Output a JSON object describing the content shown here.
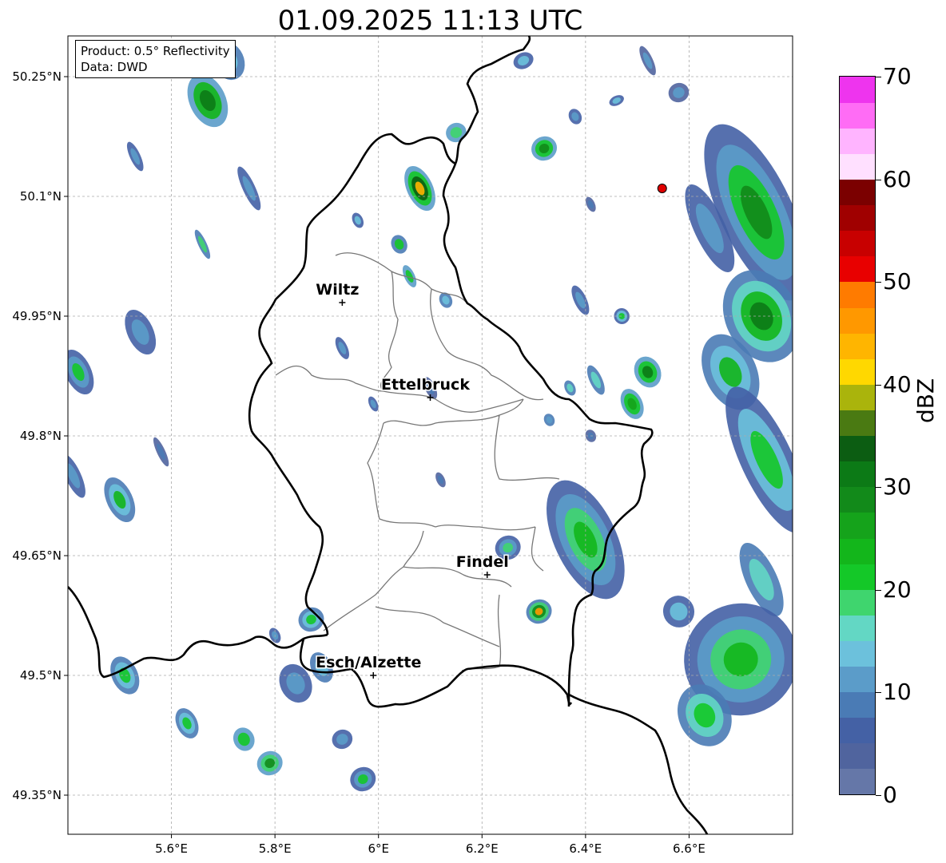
{
  "title": "01.09.2025 11:13 UTC",
  "info": {
    "product": "Product: 0.5° Reflectivity",
    "source": "Data: DWD"
  },
  "axes": {
    "lat_labels": [
      {
        "value": 50.25,
        "text": "50.25°N"
      },
      {
        "value": 50.1,
        "text": "50.1°N"
      },
      {
        "value": 49.95,
        "text": "49.95°N"
      },
      {
        "value": 49.8,
        "text": "49.8°N"
      },
      {
        "value": 49.65,
        "text": "49.65°N"
      },
      {
        "value": 49.5,
        "text": "49.5°N"
      },
      {
        "value": 49.35,
        "text": "49.35°N"
      }
    ],
    "lon_labels": [
      {
        "value": 5.6,
        "text": "5.6°E"
      },
      {
        "value": 5.8,
        "text": "5.8°E"
      },
      {
        "value": 6.0,
        "text": "6°E"
      },
      {
        "value": 6.2,
        "text": "6.2°E"
      },
      {
        "value": 6.4,
        "text": "6.4°E"
      },
      {
        "value": 6.6,
        "text": "6.6°E"
      }
    ],
    "lon_range": [
      5.4,
      6.8
    ],
    "lat_range": [
      49.3,
      50.3
    ],
    "grid": true
  },
  "places": [
    {
      "name": "Wiltz",
      "lon": 5.93,
      "lat": 49.967
    },
    {
      "name": "Ettelbruck",
      "lon": 6.1,
      "lat": 49.848
    },
    {
      "name": "Findel",
      "lon": 6.21,
      "lat": 49.626
    },
    {
      "name": "Esch/Alzette",
      "lon": 5.99,
      "lat": 49.5
    }
  ],
  "radar_site": {
    "lon": 6.548,
    "lat": 50.11,
    "color": "#e00000"
  },
  "colorbar": {
    "unit": "dBZ",
    "min": 0,
    "max": 70,
    "tick_labels": [
      {
        "value": 0,
        "text": "0"
      },
      {
        "value": 10,
        "text": "10"
      },
      {
        "value": 20,
        "text": "20"
      },
      {
        "value": 30,
        "text": "30"
      },
      {
        "value": 40,
        "text": "40"
      },
      {
        "value": 50,
        "text": "50"
      },
      {
        "value": 60,
        "text": "60"
      },
      {
        "value": 70,
        "text": "70"
      }
    ],
    "colors": [
      "#6577a8",
      "#50649e",
      "#4461a5",
      "#4a7bb5",
      "#5b9cc9",
      "#6cc1dc",
      "#63d7c4",
      "#3fd56e",
      "#14c828",
      "#13b61b",
      "#15a31b",
      "#128a1a",
      "#0c7a16",
      "#0c5d12",
      "#4a7a12",
      "#aab40c",
      "#ffd800",
      "#ffb500",
      "#ff9800",
      "#ff7b00",
      "#e80000",
      "#c80000",
      "#a00000",
      "#7b0000",
      "#ffe0ff",
      "#ffb4ff",
      "#ff6cf5",
      "#ee34ee"
    ]
  },
  "echo_cells": [
    {
      "lon": 5.67,
      "lat": 50.22,
      "rx": 0.035,
      "ry": 0.035,
      "dbz": [
        12,
        24,
        32
      ]
    },
    {
      "lon": 5.71,
      "lat": 50.27,
      "rx": 0.03,
      "ry": 0.025,
      "dbz": [
        8,
        14
      ]
    },
    {
      "lon": 5.53,
      "lat": 50.15,
      "rx": 0.01,
      "ry": 0.02,
      "dbz": [
        6,
        10
      ]
    },
    {
      "lon": 5.75,
      "lat": 50.11,
      "rx": 0.012,
      "ry": 0.03,
      "dbz": [
        5,
        10
      ]
    },
    {
      "lon": 5.66,
      "lat": 50.04,
      "rx": 0.008,
      "ry": 0.02,
      "dbz": [
        8,
        18
      ]
    },
    {
      "lon": 5.96,
      "lat": 50.07,
      "rx": 0.01,
      "ry": 0.01,
      "dbz": [
        6,
        14
      ]
    },
    {
      "lon": 6.04,
      "lat": 50.04,
      "rx": 0.015,
      "ry": 0.012,
      "dbz": [
        8,
        20
      ]
    },
    {
      "lon": 6.08,
      "lat": 50.11,
      "rx": 0.025,
      "ry": 0.03,
      "dbz": [
        10,
        22,
        34,
        44
      ]
    },
    {
      "lon": 6.15,
      "lat": 50.18,
      "rx": 0.02,
      "ry": 0.012,
      "dbz": [
        10,
        18
      ]
    },
    {
      "lon": 6.06,
      "lat": 50.0,
      "rx": 0.01,
      "ry": 0.015,
      "dbz": [
        10,
        22
      ]
    },
    {
      "lon": 6.13,
      "lat": 49.97,
      "rx": 0.012,
      "ry": 0.01,
      "dbz": [
        8,
        14
      ]
    },
    {
      "lon": 6.28,
      "lat": 50.27,
      "rx": 0.02,
      "ry": 0.01,
      "dbz": [
        6,
        14
      ]
    },
    {
      "lon": 6.32,
      "lat": 50.16,
      "rx": 0.025,
      "ry": 0.015,
      "dbz": [
        10,
        20,
        28
      ]
    },
    {
      "lon": 6.38,
      "lat": 50.2,
      "rx": 0.012,
      "ry": 0.01,
      "dbz": [
        6,
        12
      ]
    },
    {
      "lon": 6.52,
      "lat": 50.27,
      "rx": 0.01,
      "ry": 0.02,
      "dbz": [
        4,
        10
      ]
    },
    {
      "lon": 6.58,
      "lat": 50.23,
      "rx": 0.02,
      "ry": 0.012,
      "dbz": [
        4,
        10
      ]
    },
    {
      "lon": 6.46,
      "lat": 50.22,
      "rx": 0.015,
      "ry": 0.006,
      "dbz": [
        6,
        14
      ]
    },
    {
      "lon": 6.41,
      "lat": 50.09,
      "rx": 0.008,
      "ry": 0.01,
      "dbz": [
        4,
        8
      ]
    },
    {
      "lon": 6.73,
      "lat": 50.08,
      "rx": 0.07,
      "ry": 0.12,
      "dbz": [
        6,
        12,
        20,
        28
      ]
    },
    {
      "lon": 6.64,
      "lat": 50.06,
      "rx": 0.03,
      "ry": 0.06,
      "dbz": [
        6,
        12
      ]
    },
    {
      "lon": 6.74,
      "lat": 49.95,
      "rx": 0.07,
      "ry": 0.06,
      "dbz": [
        8,
        16,
        24,
        32
      ]
    },
    {
      "lon": 6.68,
      "lat": 49.88,
      "rx": 0.05,
      "ry": 0.05,
      "dbz": [
        8,
        14,
        24
      ]
    },
    {
      "lon": 6.75,
      "lat": 49.77,
      "rx": 0.05,
      "ry": 0.1,
      "dbz": [
        6,
        14,
        22
      ]
    },
    {
      "lon": 6.74,
      "lat": 49.62,
      "rx": 0.03,
      "ry": 0.05,
      "dbz": [
        8,
        16
      ]
    },
    {
      "lon": 6.7,
      "lat": 49.52,
      "rx": 0.11,
      "ry": 0.07,
      "dbz": [
        6,
        12,
        18,
        24
      ]
    },
    {
      "lon": 6.63,
      "lat": 49.45,
      "rx": 0.05,
      "ry": 0.04,
      "dbz": [
        8,
        16,
        22
      ]
    },
    {
      "lon": 6.58,
      "lat": 49.58,
      "rx": 0.03,
      "ry": 0.02,
      "dbz": [
        6,
        14
      ]
    },
    {
      "lon": 6.52,
      "lat": 49.88,
      "rx": 0.025,
      "ry": 0.02,
      "dbz": [
        10,
        22,
        32
      ]
    },
    {
      "lon": 6.49,
      "lat": 49.84,
      "rx": 0.02,
      "ry": 0.02,
      "dbz": [
        10,
        20,
        26
      ]
    },
    {
      "lon": 6.42,
      "lat": 49.87,
      "rx": 0.012,
      "ry": 0.02,
      "dbz": [
        8,
        16
      ]
    },
    {
      "lon": 6.39,
      "lat": 49.97,
      "rx": 0.012,
      "ry": 0.02,
      "dbz": [
        6,
        10
      ]
    },
    {
      "lon": 6.47,
      "lat": 49.95,
      "rx": 0.015,
      "ry": 0.01,
      "dbz": [
        6,
        14,
        22
      ]
    },
    {
      "lon": 6.37,
      "lat": 49.86,
      "rx": 0.01,
      "ry": 0.01,
      "dbz": [
        8,
        16
      ]
    },
    {
      "lon": 6.41,
      "lat": 49.8,
      "rx": 0.01,
      "ry": 0.008,
      "dbz": [
        4,
        8
      ]
    },
    {
      "lon": 6.4,
      "lat": 49.67,
      "rx": 0.06,
      "ry": 0.08,
      "dbz": [
        6,
        12,
        18,
        24
      ]
    },
    {
      "lon": 6.31,
      "lat": 49.58,
      "rx": 0.025,
      "ry": 0.015,
      "dbz": [
        8,
        18,
        28,
        46
      ]
    },
    {
      "lon": 6.25,
      "lat": 49.66,
      "rx": 0.025,
      "ry": 0.015,
      "dbz": [
        6,
        12,
        18
      ]
    },
    {
      "lon": 6.33,
      "lat": 49.82,
      "rx": 0.01,
      "ry": 0.008,
      "dbz": [
        8,
        12
      ]
    },
    {
      "lon": 6.12,
      "lat": 49.745,
      "rx": 0.008,
      "ry": 0.01,
      "dbz": [
        4,
        8
      ]
    },
    {
      "lon": 5.93,
      "lat": 49.91,
      "rx": 0.01,
      "ry": 0.015,
      "dbz": [
        6,
        12
      ]
    },
    {
      "lon": 6.1,
      "lat": 49.86,
      "rx": 0.01,
      "ry": 0.015,
      "dbz": [
        4,
        8
      ]
    },
    {
      "lon": 5.99,
      "lat": 49.84,
      "rx": 0.008,
      "ry": 0.01,
      "dbz": [
        6,
        12
      ]
    },
    {
      "lon": 5.54,
      "lat": 49.93,
      "rx": 0.025,
      "ry": 0.03,
      "dbz": [
        6,
        10
      ]
    },
    {
      "lon": 5.42,
      "lat": 49.88,
      "rx": 0.025,
      "ry": 0.03,
      "dbz": [
        6,
        12,
        22
      ]
    },
    {
      "lon": 5.41,
      "lat": 49.75,
      "rx": 0.015,
      "ry": 0.03,
      "dbz": [
        6,
        10
      ]
    },
    {
      "lon": 5.5,
      "lat": 49.72,
      "rx": 0.025,
      "ry": 0.03,
      "dbz": [
        8,
        14,
        24
      ]
    },
    {
      "lon": 5.58,
      "lat": 49.78,
      "rx": 0.008,
      "ry": 0.02,
      "dbz": [
        4,
        8
      ]
    },
    {
      "lon": 5.51,
      "lat": 49.5,
      "rx": 0.025,
      "ry": 0.025,
      "dbz": [
        8,
        14,
        20
      ]
    },
    {
      "lon": 5.63,
      "lat": 49.44,
      "rx": 0.02,
      "ry": 0.02,
      "dbz": [
        8,
        14,
        20
      ]
    },
    {
      "lon": 5.74,
      "lat": 49.42,
      "rx": 0.02,
      "ry": 0.015,
      "dbz": [
        12,
        22
      ]
    },
    {
      "lon": 5.79,
      "lat": 49.39,
      "rx": 0.025,
      "ry": 0.015,
      "dbz": [
        10,
        18,
        28
      ]
    },
    {
      "lon": 5.84,
      "lat": 49.49,
      "rx": 0.03,
      "ry": 0.025,
      "dbz": [
        6,
        12
      ]
    },
    {
      "lon": 5.89,
      "lat": 49.51,
      "rx": 0.02,
      "ry": 0.02,
      "dbz": [
        8,
        14
      ]
    },
    {
      "lon": 5.87,
      "lat": 49.57,
      "rx": 0.025,
      "ry": 0.015,
      "dbz": [
        8,
        14,
        20
      ]
    },
    {
      "lon": 5.97,
      "lat": 49.37,
      "rx": 0.025,
      "ry": 0.015,
      "dbz": [
        6,
        12,
        20
      ]
    },
    {
      "lon": 5.93,
      "lat": 49.42,
      "rx": 0.02,
      "ry": 0.012,
      "dbz": [
        6,
        10
      ]
    },
    {
      "lon": 5.8,
      "lat": 49.55,
      "rx": 0.01,
      "ry": 0.01,
      "dbz": [
        6,
        12
      ]
    }
  ]
}
